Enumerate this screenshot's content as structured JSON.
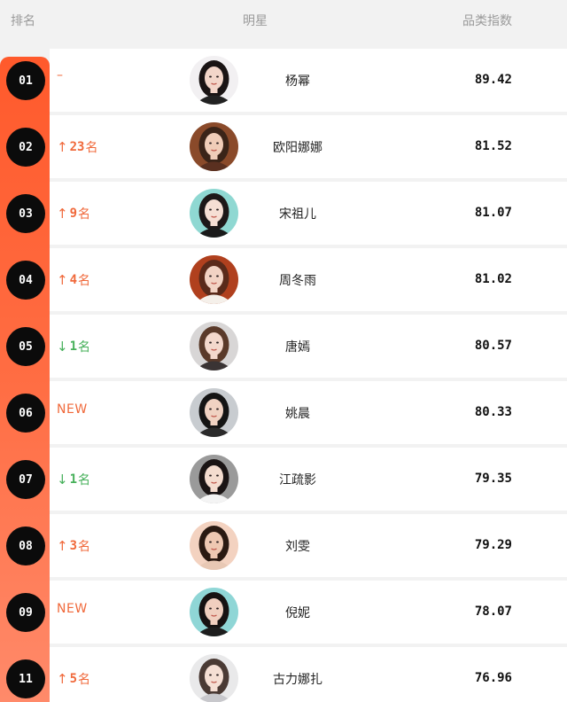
{
  "header": {
    "rank_label": "排名",
    "star_label": "明星",
    "index_label": "品类指数"
  },
  "colors": {
    "accent": "#ff5a2c",
    "up": "#f0693b",
    "down": "#46b05a"
  },
  "rows": [
    {
      "rank": "01",
      "change": {
        "type": "same",
        "arrow": "",
        "num": "",
        "unit": "",
        "text": "–"
      },
      "name": "杨幂",
      "score": "89.42",
      "avatar": {
        "bg": "#f2f0f2",
        "hair": "#1a1414",
        "skin": "#f3d6c9",
        "top": "#222222"
      }
    },
    {
      "rank": "02",
      "change": {
        "type": "up",
        "arrow": "↑",
        "num": "23",
        "unit": "名",
        "text": ""
      },
      "name": "欧阳娜娜",
      "score": "81.52",
      "avatar": {
        "bg": "#8a4a2a",
        "hair": "#3a2418",
        "skin": "#f0cdb8",
        "top": "#5a3020"
      }
    },
    {
      "rank": "03",
      "change": {
        "type": "up",
        "arrow": "↑",
        "num": "9",
        "unit": "名",
        "text": ""
      },
      "name": "宋祖儿",
      "score": "81.07",
      "avatar": {
        "bg": "#8fd8d2",
        "hair": "#1d1818",
        "skin": "#f6dfd4",
        "top": "#1a1a1a"
      }
    },
    {
      "rank": "04",
      "change": {
        "type": "up",
        "arrow": "↑",
        "num": "4",
        "unit": "名",
        "text": ""
      },
      "name": "周冬雨",
      "score": "81.02",
      "avatar": {
        "bg": "#b0401e",
        "hair": "#5a2a1a",
        "skin": "#f2d3c4",
        "top": "#f5f0ea"
      }
    },
    {
      "rank": "05",
      "change": {
        "type": "down",
        "arrow": "↓",
        "num": "1",
        "unit": "名",
        "text": ""
      },
      "name": "唐嫣",
      "score": "80.57",
      "avatar": {
        "bg": "#d8d6d6",
        "hair": "#5a3a2a",
        "skin": "#f3d8cc",
        "top": "#3a3434"
      }
    },
    {
      "rank": "06",
      "change": {
        "type": "new",
        "arrow": "",
        "num": "",
        "unit": "",
        "text": "NEW"
      },
      "name": "姚晨",
      "score": "80.33",
      "avatar": {
        "bg": "#c8ccd0",
        "hair": "#141414",
        "skin": "#f0d2c2",
        "top": "#2a2a2a"
      }
    },
    {
      "rank": "07",
      "change": {
        "type": "down",
        "arrow": "↓",
        "num": "1",
        "unit": "名",
        "text": ""
      },
      "name": "江疏影",
      "score": "79.35",
      "avatar": {
        "bg": "#9a9a9a",
        "hair": "#1a1414",
        "skin": "#f4dccf",
        "top": "#f4f4f4"
      }
    },
    {
      "rank": "08",
      "change": {
        "type": "up",
        "arrow": "↑",
        "num": "3",
        "unit": "名",
        "text": ""
      },
      "name": "刘雯",
      "score": "79.29",
      "avatar": {
        "bg": "#f3d2c0",
        "hair": "#2a1a12",
        "skin": "#eec8b2",
        "top": "#e8c8b4"
      }
    },
    {
      "rank": "09",
      "change": {
        "type": "new",
        "arrow": "",
        "num": "",
        "unit": "",
        "text": "NEW"
      },
      "name": "倪妮",
      "score": "78.07",
      "avatar": {
        "bg": "#8fd6d6",
        "hair": "#161212",
        "skin": "#f0cfbf",
        "top": "#1d1d1d"
      }
    },
    {
      "rank": "11",
      "change": {
        "type": "up",
        "arrow": "↑",
        "num": "5",
        "unit": "名",
        "text": ""
      },
      "name": "古力娜扎",
      "score": "76.96",
      "avatar": {
        "bg": "#e9e9ea",
        "hair": "#4a3a34",
        "skin": "#f5dfd4",
        "top": "#c8c8cc"
      }
    }
  ]
}
